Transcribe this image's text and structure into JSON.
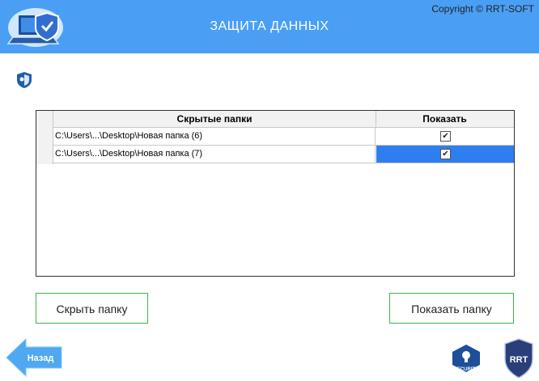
{
  "header": {
    "title": "ЗАЩИТА ДАННЫХ",
    "copyright": "Copyright © RRT-SOFT",
    "accent": "#4a9ff5"
  },
  "grid": {
    "columns": [
      "Скрытые папки",
      "Показать"
    ],
    "rows": [
      {
        "path": "C:\\Users\\...\\Desktop\\Новая папка (6)",
        "show": true,
        "selected": false
      },
      {
        "path": "C:\\Users\\...\\Desktop\\Новая папка (7)",
        "show": true,
        "selected": true
      }
    ]
  },
  "buttons": {
    "hide": "Скрыть папку",
    "show": "Показать папку",
    "back": "Назад"
  },
  "badges": {
    "security": "SECURITY",
    "rrt": "RRT"
  }
}
